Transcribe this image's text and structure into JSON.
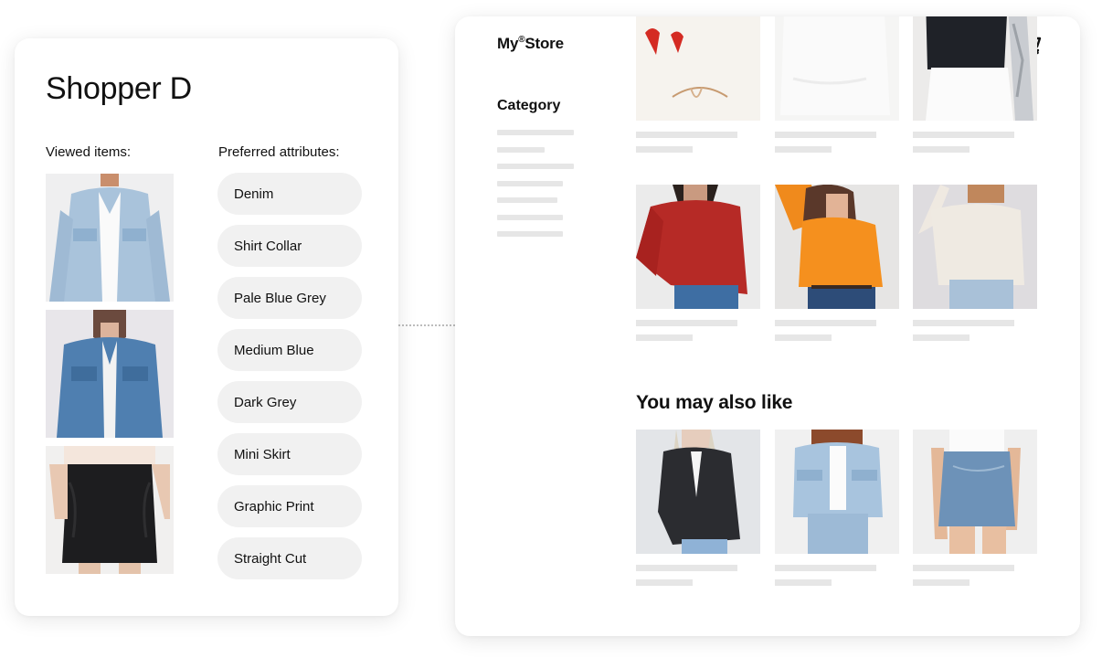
{
  "shopper": {
    "title": "Shopper D",
    "viewed_label": "Viewed items:",
    "attributes_label": "Preferred attributes:",
    "viewed_items": [
      {
        "image": "light-wash denim jacket"
      },
      {
        "image": "medium-blue denim jacket"
      },
      {
        "image": "black denim mini skirt"
      }
    ],
    "attributes": [
      {
        "label": "Denim"
      },
      {
        "label": "Shirt Collar"
      },
      {
        "label": "Pale Blue Grey"
      },
      {
        "label": "Medium Blue"
      },
      {
        "label": "Dark Grey"
      },
      {
        "label": "Mini Skirt"
      },
      {
        "label": "Graphic Print"
      },
      {
        "label": "Straight Cut"
      }
    ]
  },
  "store": {
    "logo_prefix": "My",
    "logo_mark": "®",
    "logo_suffix": "Store",
    "cart_icon": "shopping-cart-icon",
    "category_title": "Category",
    "category_placeholders": 7,
    "grid_products": [
      {
        "image": "white sweater with red hearts"
      },
      {
        "image": "white hoodie"
      },
      {
        "image": "black top with white skirt"
      },
      {
        "image": "red sweatshirt"
      },
      {
        "image": "orange sweatshirt"
      },
      {
        "image": "cream cable-knit sweater"
      }
    ],
    "recommendations_title": "You may also like",
    "recommended_products": [
      {
        "image": "black denim jacket"
      },
      {
        "image": "light-wash denim jacket and jeans"
      },
      {
        "image": "denim mini skirt"
      }
    ]
  },
  "colors": {
    "chip_bg": "#f1f1f1",
    "placeholder": "#e6e6e6",
    "text": "#111111"
  }
}
